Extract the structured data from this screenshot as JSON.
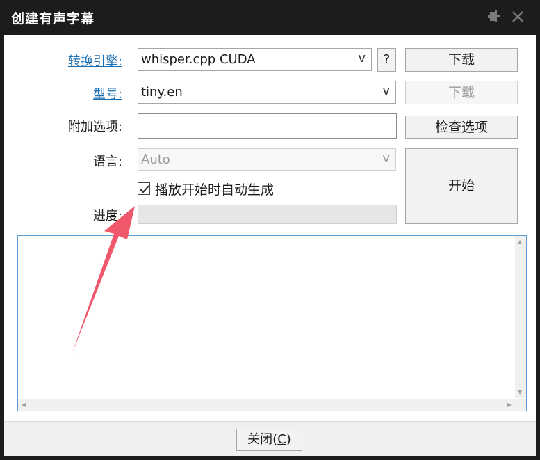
{
  "window": {
    "title": "创建有声字幕"
  },
  "form": {
    "engine_label": "转换引擎:",
    "engine_value": "whisper.cpp CUDA",
    "help_label": "?",
    "download_label_1": "下载",
    "model_label": "型号:",
    "model_value": "tiny.en",
    "download_label_2": "下载",
    "options_label": "附加选项:",
    "options_value": "",
    "check_options_label": "检查选项",
    "language_label": "语言:",
    "language_value": "Auto",
    "start_label": "开始",
    "autostart_label": "播放开始时自动生成",
    "autostart_checked": true,
    "progress_label": "进度:",
    "progress_value": 0,
    "dropdown_glyph": "v"
  },
  "log": {
    "text": ""
  },
  "footer": {
    "close_label_prefix": "关闭(",
    "close_label_key": "C",
    "close_label_suffix": ")"
  },
  "colors": {
    "titlebar": "#1c1c1c",
    "link": "#1a6fb3",
    "accent_arrow": "#f0576a",
    "log_border": "#5b9bd5"
  }
}
